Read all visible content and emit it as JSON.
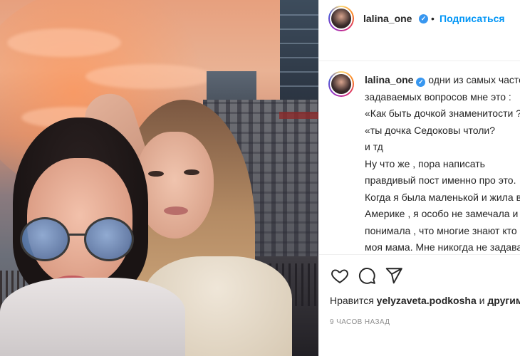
{
  "post": {
    "username": "lalina_one",
    "separator": "•",
    "follow_label": "Подписаться",
    "verified_icon": "check-icon",
    "accent_color": "#0095f6",
    "verified_color": "#3897f0"
  },
  "caption": {
    "username": "lalina_one",
    "lines": [
      "одни из самых часто",
      "задаваемых вопросов мне это :",
      "«Как быть дочкой знаменитости ?»",
      "«ты дочка Седоковы чтоли?",
      "и тд",
      "Ну что же , пора написать",
      "правдивый пост именно про это.",
      "Когда я была маленькой и жила в",
      "Америке , я особо не замечала и не",
      "понимала , что многие знают кто",
      "моя мама. Мне никогда не задавали"
    ]
  },
  "actions": {
    "like_icon": "heart-icon",
    "comment_icon": "comment-icon",
    "share_icon": "share-icon"
  },
  "likes": {
    "prefix": "Нравится",
    "user": "yelyzaveta.podkosha",
    "suffix": "и",
    "others": "другим"
  },
  "timestamp": "9 часов назад"
}
